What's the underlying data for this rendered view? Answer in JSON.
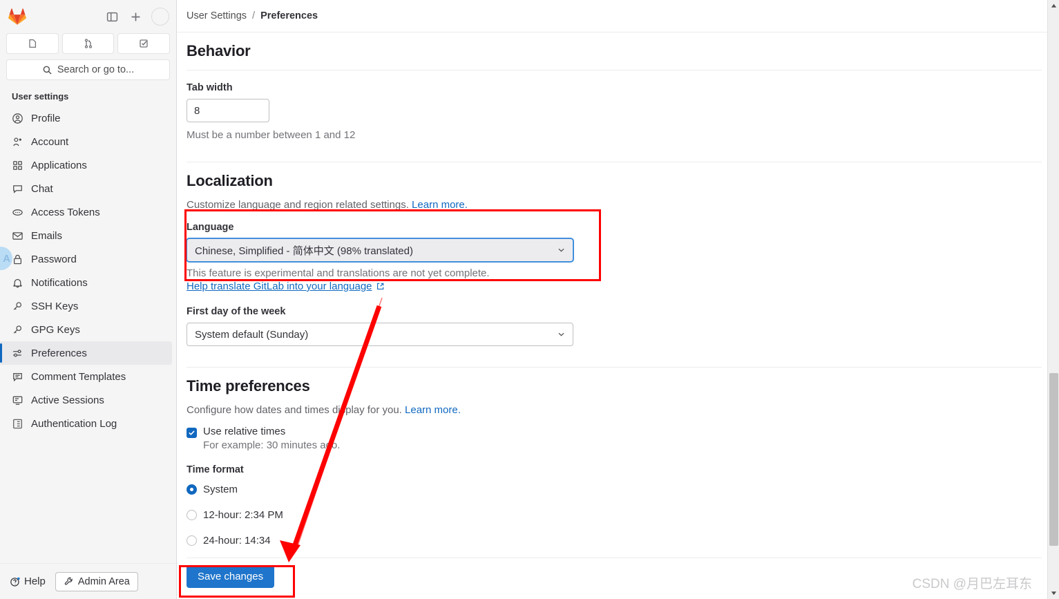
{
  "sidebar": {
    "logo": "gitlab-logo",
    "top_actions": [
      {
        "name": "toggle-sidebar-icon",
        "label": "Toggle sidebar"
      },
      {
        "name": "create-new-icon",
        "label": "Create new"
      },
      {
        "name": "user-avatar",
        "label": ""
      }
    ],
    "tiles": [
      {
        "name": "issues-icon",
        "label": "Issues"
      },
      {
        "name": "merge-requests-icon",
        "label": "Merge requests"
      },
      {
        "name": "todo-list-icon",
        "label": "To-Do List"
      }
    ],
    "search": {
      "placeholder": "Search or go to...",
      "icon": "search-icon"
    },
    "section_title": "User settings",
    "items": [
      {
        "label": "Profile",
        "icon": "user-circle-icon",
        "active": false
      },
      {
        "label": "Account",
        "icon": "account-icon",
        "active": false
      },
      {
        "label": "Applications",
        "icon": "applications-grid-icon",
        "active": false
      },
      {
        "label": "Chat",
        "icon": "chat-bubble-icon",
        "active": false
      },
      {
        "label": "Access Tokens",
        "icon": "token-icon",
        "active": false
      },
      {
        "label": "Emails",
        "icon": "envelope-icon",
        "active": false
      },
      {
        "label": "Password",
        "icon": "lock-icon",
        "active": false
      },
      {
        "label": "Notifications",
        "icon": "bell-icon",
        "active": false
      },
      {
        "label": "SSH Keys",
        "icon": "key-icon",
        "active": false
      },
      {
        "label": "GPG Keys",
        "icon": "key-icon",
        "active": false
      },
      {
        "label": "Preferences",
        "icon": "sliders-icon",
        "active": true
      },
      {
        "label": "Comment Templates",
        "icon": "comment-lines-icon",
        "active": false
      },
      {
        "label": "Active Sessions",
        "icon": "monitor-icon",
        "active": false
      },
      {
        "label": "Authentication Log",
        "icon": "log-list-icon",
        "active": false
      }
    ],
    "partial_avatar_initials": "A",
    "footer": {
      "help_label": "Help",
      "help_icon": "question-circle-icon",
      "admin_label": "Admin Area",
      "admin_icon": "wrench-icon"
    }
  },
  "breadcrumb": {
    "parent": "User Settings",
    "separator": "/",
    "current": "Preferences"
  },
  "main": {
    "behavior": {
      "heading": "Behavior",
      "tab_width_label": "Tab width",
      "tab_width_value": "8",
      "tab_width_hint": "Must be a number between 1 and 12"
    },
    "localization": {
      "heading": "Localization",
      "description": "Customize language and region related settings.",
      "description_link": "Learn more.",
      "language_label": "Language",
      "language_value": "Chinese, Simplified - 简体中文 (98% translated)",
      "language_hint": "This feature is experimental and translations are not yet complete.",
      "translate_link": "Help translate GitLab into your language",
      "translate_link_icon": "external-link-icon",
      "first_day_label": "First day of the week",
      "first_day_value": "System default (Sunday)"
    },
    "time_preferences": {
      "heading": "Time preferences",
      "description": "Configure how dates and times display for you.",
      "description_link": "Learn more.",
      "relative_times_label": "Use relative times",
      "relative_times_hint": "For example: 30 minutes ago.",
      "relative_times_checked": true,
      "time_format_label": "Time format",
      "time_format_options": [
        {
          "label": "System",
          "selected": true
        },
        {
          "label": "12-hour: 2:34 PM",
          "selected": false
        },
        {
          "label": "24-hour: 14:34",
          "selected": false
        }
      ]
    },
    "save_label": "Save changes"
  },
  "annotations": {
    "highlight_color": "#ff0000",
    "arrow_color": "#ff0000",
    "boxes": [
      "language-section-highlight",
      "save-changes-highlight"
    ],
    "arrow": "points-from-language-section-to-save-changes"
  },
  "watermark": "CSDN @月巴左耳东",
  "colors": {
    "accent_blue": "#1f75cb",
    "link_blue": "#1068bf",
    "sidebar_bg": "#f5f5f5",
    "annotation_red": "#ff0000"
  }
}
